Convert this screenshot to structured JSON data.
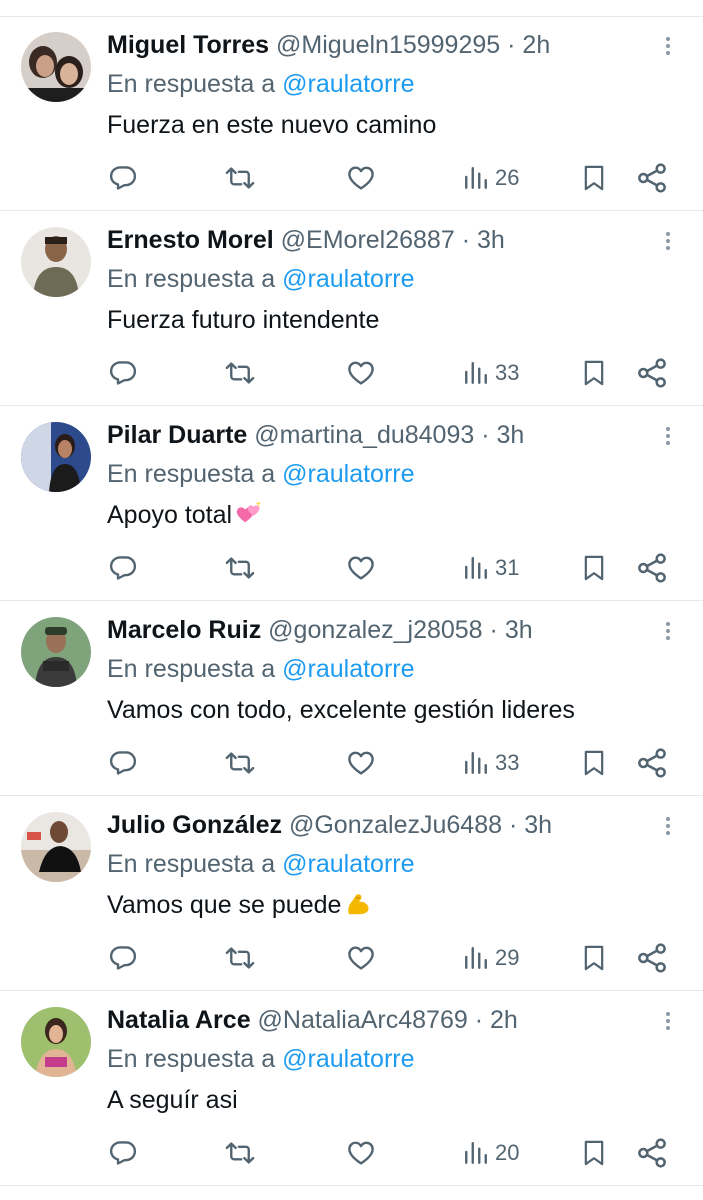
{
  "tweets": [
    {
      "name": "Miguel Torres",
      "handle": "@Migueln15999295",
      "separator": "·",
      "time": "2h",
      "reply_prefix": "En respuesta a",
      "reply_to": "@raulatorre",
      "text": "Fuerza en este nuevo camino",
      "emoji": "",
      "views": "26",
      "avatar_icon": "avatar-photo"
    },
    {
      "name": "Ernesto Morel",
      "handle": "@EMorel26887",
      "separator": "·",
      "time": "3h",
      "reply_prefix": "En respuesta a",
      "reply_to": "@raulatorre",
      "text": "Fuerza futuro intendente",
      "emoji": "",
      "views": "33",
      "avatar_icon": "avatar-photo"
    },
    {
      "name": "Pilar Duarte",
      "handle": "@martina_du84093",
      "separator": "·",
      "time": "3h",
      "reply_prefix": "En respuesta a",
      "reply_to": "@raulatorre",
      "text": "Apoyo total",
      "emoji": "sparkling-hearts",
      "views": "31",
      "avatar_icon": "avatar-photo"
    },
    {
      "name": "Marcelo Ruiz",
      "handle": "@gonzalez_j28058",
      "separator": "·",
      "time": "3h",
      "reply_prefix": "En respuesta a",
      "reply_to": "@raulatorre",
      "text": "Vamos con todo, excelente gestión lideres",
      "emoji": "",
      "views": "33",
      "avatar_icon": "avatar-photo"
    },
    {
      "name": "Julio González",
      "handle": "@GonzalezJu6488",
      "separator": "·",
      "time": "3h",
      "reply_prefix": "En respuesta a",
      "reply_to": "@raulatorre",
      "text": "Vamos que se puede",
      "emoji": "flexed-biceps",
      "views": "29",
      "avatar_icon": "avatar-photo"
    },
    {
      "name": "Natalia Arce",
      "handle": "@NataliaArc48769",
      "separator": "·",
      "time": "2h",
      "reply_prefix": "En respuesta a",
      "reply_to": "@raulatorre",
      "text": "A seguír asi",
      "emoji": "",
      "views": "20",
      "avatar_icon": "avatar-photo"
    }
  ],
  "colors": {
    "text": "#0f1419",
    "secondary": "#536471",
    "link": "#1d9bf0",
    "divider": "#e6e9ec"
  },
  "icons": {
    "reply": "reply-icon",
    "retweet": "retweet-icon",
    "like": "like-icon",
    "views": "views-icon",
    "bookmark": "bookmark-icon",
    "share": "share-icon",
    "more": "more-options-icon"
  }
}
